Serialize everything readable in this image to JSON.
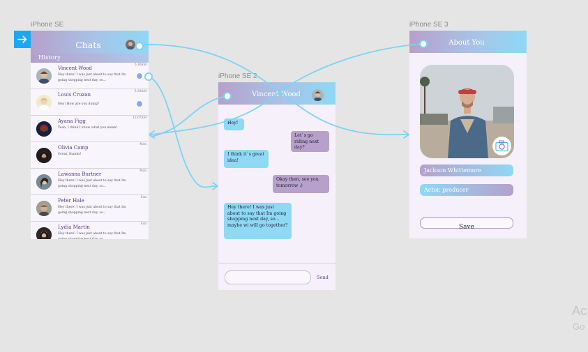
{
  "frames": {
    "chats_label": "iPhone SE",
    "chat_label": "iPhone SE 2",
    "about_label": "iPhone SE 3"
  },
  "chats": {
    "title": "Chats",
    "tab": "History",
    "items": [
      {
        "name": "Vincent Wood",
        "message": "Hey there! I was just about to say that Im going shopping next day, so...",
        "time": "5:30AM",
        "unread": true
      },
      {
        "name": "Louis Cruzan",
        "message": "Hey! How are you doing?",
        "time": "5:30AM",
        "unread": true
      },
      {
        "name": "Ayana Figg",
        "message": "Yeah, I think I know what you mean!",
        "time": "12:07AM",
        "unread": false
      },
      {
        "name": "Olivia Camp",
        "message": "Great, thanks!",
        "time": "Mon",
        "unread": false
      },
      {
        "name": "Lawanna Burtner",
        "message": "Hey there! I was just about to say that Im going shopping next day, so...",
        "time": "Mon",
        "unread": false
      },
      {
        "name": "Peter Hale",
        "message": "Hey there! I was just about to say that Im going shopping next day, so...",
        "time": "Sun",
        "unread": false
      },
      {
        "name": "Lydia Martin",
        "message": "Hey there! I was just about to say that Im going shopping next day, so...",
        "time": "Sun",
        "unread": false
      }
    ]
  },
  "chat": {
    "title": "Vincent Wood",
    "messages": [
      {
        "text": "Hey!",
        "direction": "in"
      },
      {
        "text": "Let`s go riding next day?",
        "direction": "out"
      },
      {
        "text": "I think it`s great idea!",
        "direction": "in"
      },
      {
        "text": "Okay then, see you tomorrow :)",
        "direction": "out"
      },
      {
        "text": "Hey there! I was just about to say that Im going shopping next day, so... maybe wi will go together?",
        "direction": "in"
      }
    ],
    "input_placeholder": "",
    "send_label": "Send"
  },
  "about": {
    "title": "About You",
    "name_value": "Jackson Whittemore",
    "role_value": "Actor, producer",
    "save_label": "Save"
  },
  "watermark": {
    "line1": "Ac",
    "line2": "Go"
  },
  "colors": {
    "canvas": "#e5e5e5",
    "frame_bg": "#f5f0fa",
    "gradient_start": "#b6a0cc",
    "gradient_end": "#8fd8f6",
    "prototype_link": "#7fd3f3",
    "bubble_in": "#8fd9f4",
    "bubble_out": "#b7a0c9",
    "accent_purple": "#5a3a8a"
  }
}
